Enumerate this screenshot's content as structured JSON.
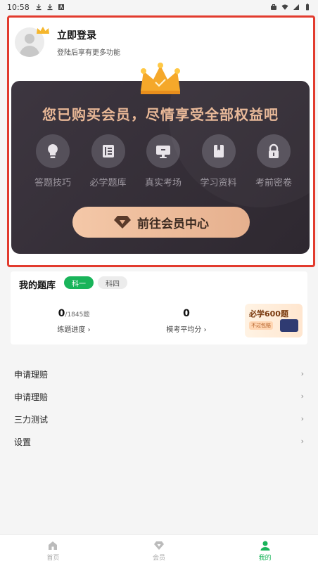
{
  "status_bar": {
    "time": "10:58",
    "left_icons": [
      "download-icon",
      "download-icon",
      "a-box-icon"
    ],
    "right_icons": [
      "briefcase-icon",
      "wifi-icon",
      "signal-icon",
      "battery-icon"
    ]
  },
  "profile": {
    "title": "立即登录",
    "subtitle": "登陆后享有更多功能",
    "badge_icon": "crown-icon"
  },
  "vip": {
    "headline": "您已购买会员，尽情享受全部权益吧",
    "benefits": [
      {
        "label": "答题技巧",
        "icon": "lightbulb-icon"
      },
      {
        "label": "必学题库",
        "icon": "notebook-icon"
      },
      {
        "label": "真实考场",
        "icon": "monitor-icon"
      },
      {
        "label": "学习资料",
        "icon": "book-icon"
      },
      {
        "label": "考前密卷",
        "icon": "lock-icon"
      }
    ],
    "button_label": "前往会员中心",
    "accent": "#e8b796"
  },
  "bank": {
    "title": "我的题库",
    "tabs": [
      "科一",
      "科四"
    ],
    "progress_num": "0",
    "progress_total": "/1845题",
    "progress_label": "练题进度 ›",
    "avg_num": "0",
    "avg_label": "模考平均分 ›",
    "promo_title": "必学600题",
    "promo_tag": "不过包赔"
  },
  "menu": [
    {
      "label": "申请理赔",
      "chevron": "›"
    },
    {
      "label": "申请理赔",
      "chevron": "›"
    },
    {
      "label": "三力测试",
      "chevron": "›"
    },
    {
      "label": "设置",
      "chevron": "›"
    }
  ],
  "nav": [
    {
      "label": "首页",
      "icon": "home-icon"
    },
    {
      "label": "会员",
      "icon": "diamond-icon"
    },
    {
      "label": "我的",
      "icon": "person-icon",
      "active": true
    }
  ],
  "colors": {
    "brand_green": "#19b45a",
    "highlight_red": "#e23b2e"
  }
}
